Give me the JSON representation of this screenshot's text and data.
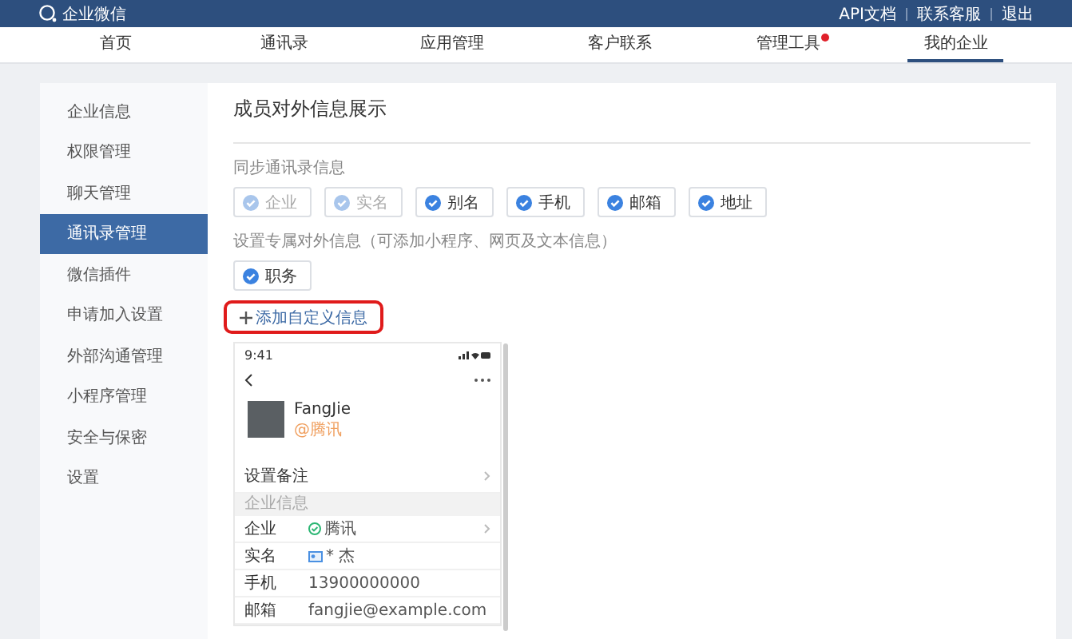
{
  "topbar": {
    "logo": "企业微信",
    "links": [
      "API文档",
      "联系客服",
      "退出"
    ]
  },
  "nav": [
    {
      "label": "首页",
      "selected": false,
      "badge": false
    },
    {
      "label": "通讯录",
      "selected": false,
      "badge": false
    },
    {
      "label": "应用管理",
      "selected": false,
      "badge": false
    },
    {
      "label": "客户联系",
      "selected": false,
      "badge": false
    },
    {
      "label": "管理工具",
      "selected": false,
      "badge": true
    },
    {
      "label": "我的企业",
      "selected": true,
      "badge": false
    }
  ],
  "sidebar": {
    "items": [
      {
        "label": "企业信息",
        "selected": false
      },
      {
        "label": "权限管理",
        "selected": false
      },
      {
        "label": "聊天管理",
        "selected": false
      },
      {
        "label": "通讯录管理",
        "selected": true
      },
      {
        "label": "微信插件",
        "selected": false
      },
      {
        "label": "申请加入设置",
        "selected": false
      },
      {
        "label": "外部沟通管理",
        "selected": false
      },
      {
        "label": "小程序管理",
        "selected": false
      },
      {
        "label": "安全与保密",
        "selected": false
      },
      {
        "label": "设置",
        "selected": false
      }
    ]
  },
  "content": {
    "title": "成员对外信息展示",
    "sync_label": "同步通讯录信息",
    "sync_fields": [
      {
        "label": "企业",
        "checked": true,
        "disabled": true
      },
      {
        "label": "实名",
        "checked": true,
        "disabled": true
      },
      {
        "label": "别名",
        "checked": true,
        "disabled": false
      },
      {
        "label": "手机",
        "checked": true,
        "disabled": false
      },
      {
        "label": "邮箱",
        "checked": true,
        "disabled": false
      },
      {
        "label": "地址",
        "checked": true,
        "disabled": false
      }
    ],
    "custom_label": "设置专属对外信息（可添加小程序、网页及文本信息）",
    "custom_fields": [
      {
        "label": "职务",
        "checked": true,
        "disabled": false
      }
    ],
    "add_button": "添加自定义信息",
    "preview": {
      "time": "9:41",
      "name": "FangJie",
      "company": "@腾讯",
      "remark": "设置备注",
      "section": "企业信息",
      "rows": [
        {
          "label": "企业",
          "value": "腾讯",
          "kind": "verified"
        },
        {
          "label": "实名",
          "value": "* 杰",
          "kind": "id"
        },
        {
          "label": "手机",
          "value": "13900000000",
          "kind": "plain"
        },
        {
          "label": "邮箱",
          "value": "fangjie@example.com",
          "kind": "plain"
        }
      ]
    }
  }
}
